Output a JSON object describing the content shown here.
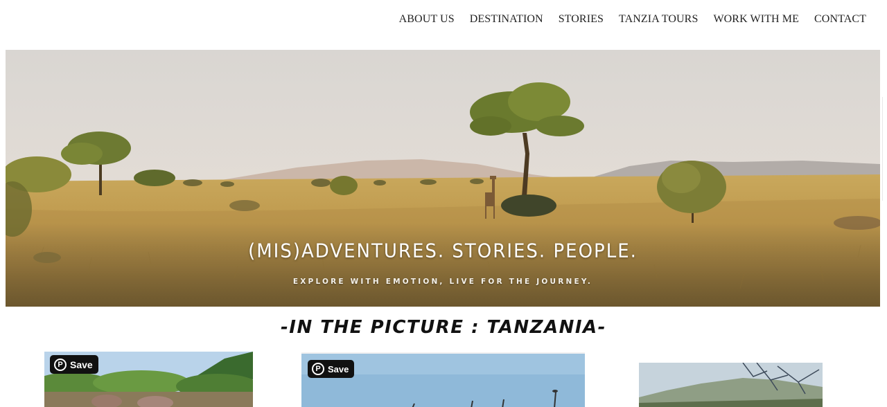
{
  "nav": {
    "items": [
      {
        "label": "ABOUT US",
        "name": "nav-about-us"
      },
      {
        "label": "DESTINATION",
        "name": "nav-destination"
      },
      {
        "label": "STORIES",
        "name": "nav-stories"
      },
      {
        "label": "TANZIA TOURS",
        "name": "nav-tanzia-tours"
      },
      {
        "label": "WORK WITH ME",
        "name": "nav-work-with-me"
      },
      {
        "label": "CONTACT",
        "name": "nav-contact"
      }
    ]
  },
  "hero": {
    "title": "(MIS)ADVENTURES. STORIES. PEOPLE.",
    "subtitle": "EXPLORE WITH EMOTION, LIVE FOR THE JOURNEY."
  },
  "section": {
    "title": "-IN THE PICTURE : TANZANIA-"
  },
  "cards": [
    {
      "save_label": "Save",
      "pin_glyph": "P"
    },
    {
      "save_label": "Save",
      "pin_glyph": "P"
    }
  ],
  "colors": {
    "save_button": "#111111",
    "nav_text": "#222222"
  },
  "icons": {
    "save": "pinterest-icon"
  }
}
